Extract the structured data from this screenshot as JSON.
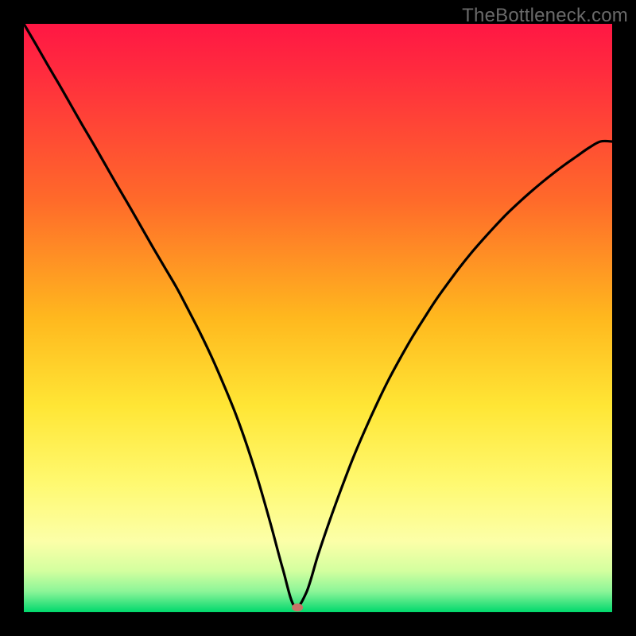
{
  "watermark": "TheBottleneck.com",
  "chart_data": {
    "type": "line",
    "title": "",
    "xlabel": "",
    "ylabel": "",
    "xlim": [
      0,
      100
    ],
    "ylim": [
      0,
      100
    ],
    "x": [
      0,
      2,
      4,
      6,
      8,
      10,
      12,
      14,
      16,
      18,
      20,
      22,
      24,
      26,
      28,
      30,
      32,
      34,
      36,
      38,
      40,
      42,
      44,
      46,
      48,
      50,
      52,
      54,
      56,
      58,
      60,
      62,
      64,
      66,
      68,
      70,
      72,
      74,
      76,
      78,
      80,
      82,
      84,
      86,
      88,
      90,
      92,
      94,
      96,
      98,
      100
    ],
    "values": [
      100,
      96.6,
      93.1,
      89.7,
      86.2,
      82.7,
      79.3,
      75.8,
      72.3,
      68.9,
      65.4,
      61.9,
      58.5,
      55.1,
      51.3,
      47.4,
      43.2,
      38.6,
      33.7,
      28.1,
      21.8,
      14.8,
      7.4,
      1.0,
      3.3,
      9.7,
      15.6,
      21.1,
      26.3,
      31.0,
      35.4,
      39.5,
      43.2,
      46.7,
      49.9,
      53.0,
      55.8,
      58.5,
      61.0,
      63.3,
      65.5,
      67.6,
      69.5,
      71.3,
      73.0,
      74.6,
      76.1,
      77.5,
      78.9,
      80.0,
      80.0
    ],
    "minimum_marker": {
      "x": 46.5,
      "y": 0.8
    },
    "gradient_stops": [
      {
        "offset": 0.0,
        "color": "#ff1744"
      },
      {
        "offset": 0.08,
        "color": "#ff2b3e"
      },
      {
        "offset": 0.3,
        "color": "#ff6a2a"
      },
      {
        "offset": 0.5,
        "color": "#ffb81e"
      },
      {
        "offset": 0.65,
        "color": "#ffe635"
      },
      {
        "offset": 0.78,
        "color": "#fff970"
      },
      {
        "offset": 0.88,
        "color": "#fcffa8"
      },
      {
        "offset": 0.93,
        "color": "#d3ff9f"
      },
      {
        "offset": 0.965,
        "color": "#8bf598"
      },
      {
        "offset": 0.985,
        "color": "#3de480"
      },
      {
        "offset": 1.0,
        "color": "#00d96c"
      }
    ]
  }
}
